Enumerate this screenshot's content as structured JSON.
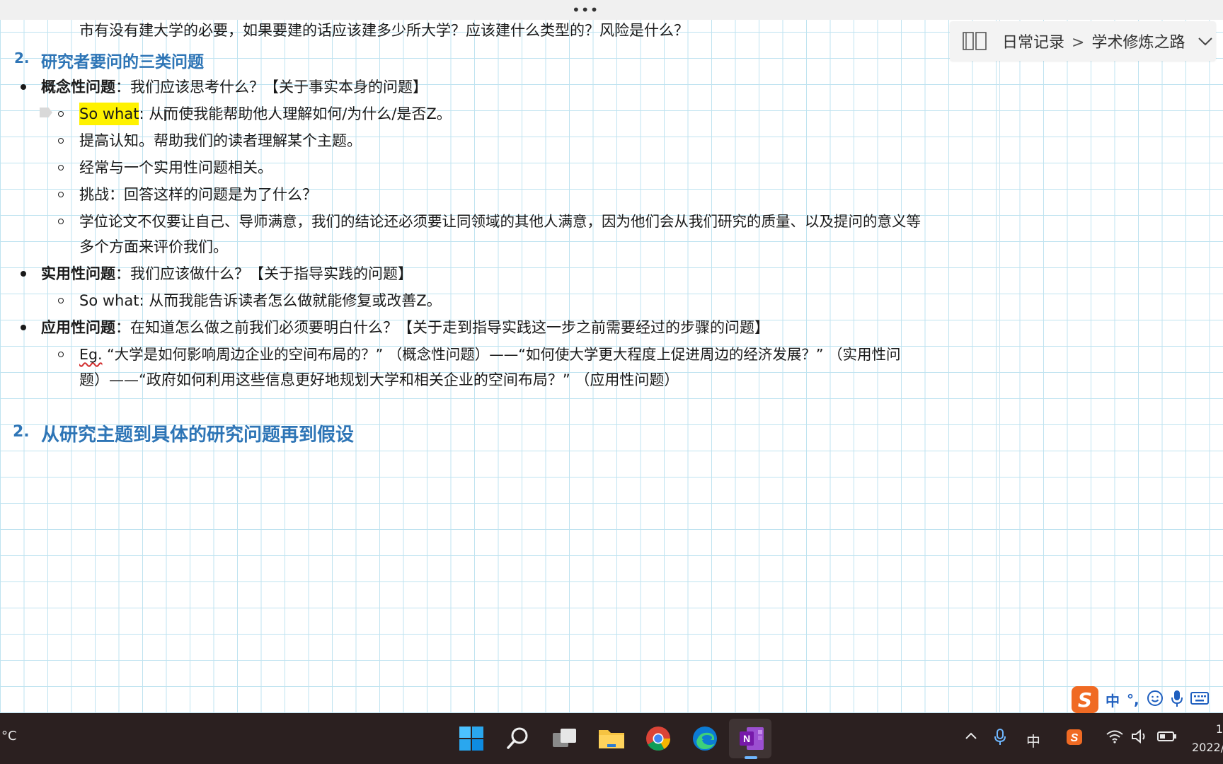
{
  "top_bar": {
    "more": "•••"
  },
  "breadcrumb": {
    "notebook": "日常记录",
    "separator": ">",
    "section": "学术修炼之路"
  },
  "note": {
    "line0": "市有没有建大学的必要，如果要建的话应该建多少所大学？应该建什么类型的？风险是什么？",
    "heading1": {
      "num": "2.",
      "text": "研究者要问的三类问题"
    },
    "b1": {
      "bold": "概念性问题",
      "rest": "：我们应该思考什么？【关于事实本身的问题】"
    },
    "b1_subs": [
      {
        "highlight": "So what",
        "rest": ": 从而使我能帮助他人理解如何/为什么/是否Z。"
      },
      {
        "text": "提高认知。帮助我们的读者理解某个主题。"
      },
      {
        "text": "经常与一个实用性问题相关。"
      },
      {
        "text": "挑战：回答这样的问题是为了什么？"
      },
      {
        "text": "学位论文不仅要让自己、导师满意，我们的结论还必须要让同领域的其他人满意，因为他们会从我们研究的质量、以及提问的意义等",
        "cont": "多个方面来评价我们。"
      }
    ],
    "b2": {
      "bold": "实用性问题",
      "rest": "：我们应该做什么？【关于指导实践的问题】"
    },
    "b2_sub": "So what: 从而我能告诉读者怎么做就能修复或改善Z。",
    "b3": {
      "bold": "应用性问题",
      "rest": "：在知道怎么做之前我们必须要明白什么？【关于走到指导实践这一步之前需要经过的步骤的问题】"
    },
    "b3_sub": {
      "eg": "Eg.",
      "line1": " “大学是如何影响周边企业的空间布局的？” （概念性问题）——“如何使大学更大程度上促进周边的经济发展？” （实用性问",
      "line2": "题）——“政府如何利用这些信息更好地规划大学和相关企业的空间布局？” （应用性问题）"
    },
    "heading2": {
      "num": "2.",
      "text": "从研究主题到具体的研究问题再到假设"
    }
  },
  "ime": {
    "lang": "中",
    "punct": "°,",
    "logo": "S"
  },
  "taskbar": {
    "weather": "°C",
    "tray_lang": "中",
    "clock_time": "1",
    "clock_date": "2022/"
  },
  "colors": {
    "heading": "#2e75b6",
    "highlight": "#fff200",
    "taskbar": "#2b2020",
    "grid": "#bfe3f0"
  }
}
